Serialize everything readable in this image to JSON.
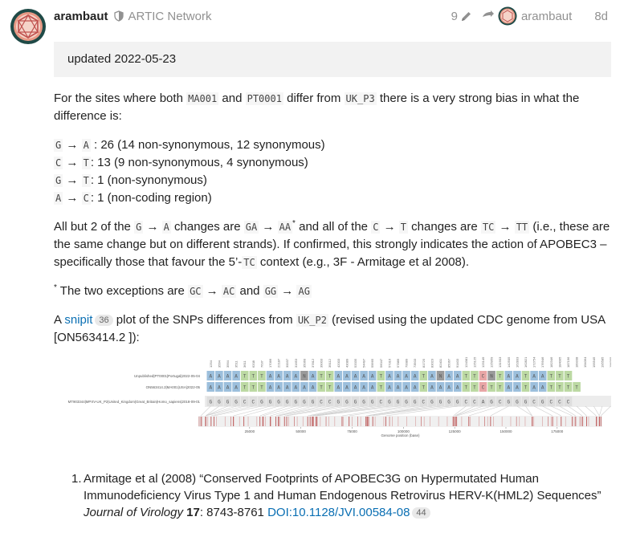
{
  "header": {
    "username": "arambaut",
    "group_name": "ARTIC Network",
    "edit_count": "9",
    "reply_to_username": "arambaut",
    "post_date": "8d"
  },
  "icons": {
    "avatar": "arambaut-avatar-icon",
    "moderator": "shield-icon",
    "edit": "pencil-icon",
    "reply": "reply-arrow-icon"
  },
  "colors": {
    "link": "#0a6fb3",
    "muted": "#919191",
    "quote_bg": "#f2f2f2",
    "avatar_ring": "#e07a5f"
  },
  "body": {
    "updated_note": "updated 2022-05-23",
    "intro_p1": "For the sites where both ",
    "code_ma001": "MA001",
    "intro_p2": " and ",
    "code_pt0001": "PT0001",
    "intro_p3": " differ from ",
    "code_ukp3": "UK_P3",
    "intro_p4": " there is a very strong bias in what the difference is:",
    "change_lines": [
      {
        "from": "G",
        "arrow": " → ",
        "to": "A",
        "text": " : 26 (14 non-synonymous, 12 synonymous)"
      },
      {
        "from": "C",
        "arrow": " → ",
        "to": "T",
        "text": ": 13 (9 non-synonymous, 4 synonymous)"
      },
      {
        "from": "G",
        "arrow": " → ",
        "to": "T",
        "text": ": 1 (non-synonymous)"
      },
      {
        "from": "A",
        "arrow": " → ",
        "to": "C",
        "text": ": 1 (non-coding region)"
      }
    ],
    "p3_a": "All but 2 of the ",
    "p3_g": "G",
    "p3_arrow1": " → ",
    "p3_a2": "A",
    "p3_b": " changes are ",
    "p3_ga": "GA",
    "p3_arrow2": " → ",
    "p3_aa": "AA",
    "p3_sup": "*",
    "p3_c": " and all of the ",
    "p3_c2": "C",
    "p3_arrow3": " → ",
    "p3_t": "T",
    "p3_d": " changes are ",
    "p3_tc": "TC",
    "p3_arrow4": " → ",
    "p3_tt": "TT",
    "p3_e": " (i.e., these are the same change but on different strands). If confirmed, this strongly indicates the action of APOBEC3 – specifically those that favour the 5’-",
    "p3_tc2": "TC",
    "p3_f": " context (e.g., 3F - Armitage et al 2008).",
    "p4_sup": "*",
    "p4_a": " The two exceptions are ",
    "p4_gc": "GC",
    "p4_arrow1": " → ",
    "p4_ac": "AC",
    "p4_b": " and ",
    "p4_gg": "GG",
    "p4_arrow2": " → ",
    "p4_ag": "AG",
    "p5_a": "A ",
    "p5_link": "snipit",
    "p5_count": "36",
    "p5_b": " plot of the SNPs differences from ",
    "p5_code": "UK_P2",
    "p5_c": " (revised using the updated CDC genome from USA [ON563414.2 ]):"
  },
  "snipit": {
    "row_labels": [
      "Unpublished|PT0001|Portugal|2022-05-04",
      "ON563414.2|MA001|USA|2022-05",
      "MT903344|MPXV-UK_P2|United_Kingdom|Great_Britain|Homo_sapiens|2018-09-01"
    ],
    "axis_label": "Genome position (base)",
    "axis_ticks": [
      "25000",
      "50000",
      "75000",
      "100000",
      "125000",
      "150000",
      "175000"
    ],
    "axis_tick_values": [
      25000,
      50000,
      75000,
      100000,
      125000,
      150000,
      175000
    ],
    "genome_length": 197000,
    "row1": "AAAATTTAAAANATTAAAAATAAAATANAATTCNTAATAATTT",
    "row2": "AAAATTTAAAAAATTAAAAATAAAATAAAATTCTTAATAATTTT",
    "row3": "GGGGCCGGGGGGGCCGGGGGCGGGGCGGGGCCAGCGGGCGCCC",
    "positions": [
      "1254",
      "3564",
      "3564",
      "3511",
      "3611",
      "6208",
      "7637",
      "17066",
      "22187",
      "30037",
      "31653",
      "35060",
      "37812",
      "39003",
      "39112",
      "42003",
      "43089",
      "53335",
      "54497",
      "55665",
      "56047",
      "57316",
      "57889",
      "70089",
      "73503",
      "81725",
      "83023",
      "82401",
      "85067",
      "91403",
      "124381",
      "125125",
      "125149",
      "125959",
      "131903",
      "142505",
      "162833",
      "162821",
      "172754",
      "176946",
      "182346",
      "184005",
      "187196",
      "189338",
      "194064",
      "195545",
      "195585",
      "196305"
    ],
    "site_genome_positions": [
      1254,
      3564,
      3564,
      3511,
      3611,
      6208,
      7637,
      17066,
      22187,
      30037,
      31653,
      35060,
      37812,
      39003,
      39112,
      42003,
      43089,
      53335,
      54497,
      55665,
      56047,
      57316,
      57889,
      70089,
      73503,
      81725,
      83023,
      82401,
      85067,
      91403,
      124381,
      125125,
      125149,
      125959,
      131903,
      142505,
      162833,
      162821,
      172754,
      176946,
      182346,
      184005,
      187196,
      189338,
      194064,
      195545,
      195585,
      196305
    ]
  },
  "references": [
    {
      "num": "1.",
      "authors": "Armitage et al (2008) “Conserved Footprints of APOBEC3G on Hypermutated Human Immunodeficiency Virus Type 1 and Human Endogenous Retrovirus HERV-K(HML2) Sequences” ",
      "journal": "Journal of Virology",
      "volume": "17",
      "pages": ": 8743-8761 ",
      "doi": "DOI:10.1128/JVI.00584-08",
      "doi_count": "44"
    }
  ]
}
